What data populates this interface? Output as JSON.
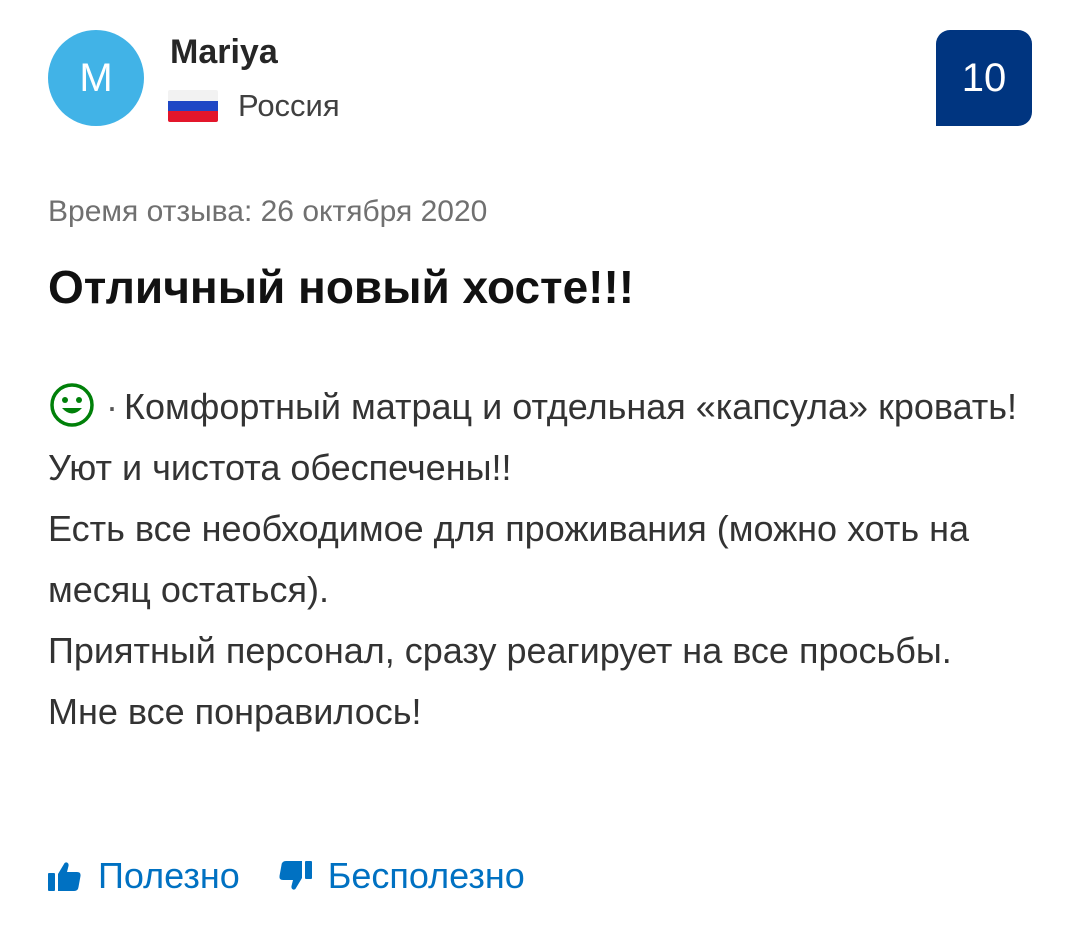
{
  "reviewer": {
    "initial": "M",
    "name": "Mariya",
    "country": "Россия",
    "avatar_color": "#41b3e7"
  },
  "score": {
    "value": "10",
    "color": "#003580"
  },
  "review": {
    "date_text": "Время отзыва: 26 октября 2020",
    "title": "Отличный новый хосте!!!",
    "positive_icon": "smile-icon",
    "positive_separator": "·",
    "positive_lines": [
      "Комфортный матрац и отдельная «капсула» кровать! Уют и чистота обеспечены!!",
      "Есть все необходимое для проживания (можно хоть на месяц остаться).",
      "Приятный персонал, сразу реагирует на все просьбы.",
      "Мне все понравилось!"
    ]
  },
  "actions": {
    "helpful_label": "Полезно",
    "helpful_icon": "thumbs-up-icon",
    "not_helpful_label": "Бесполезно",
    "not_helpful_icon": "thumbs-down-icon",
    "link_color": "#0071c2"
  }
}
